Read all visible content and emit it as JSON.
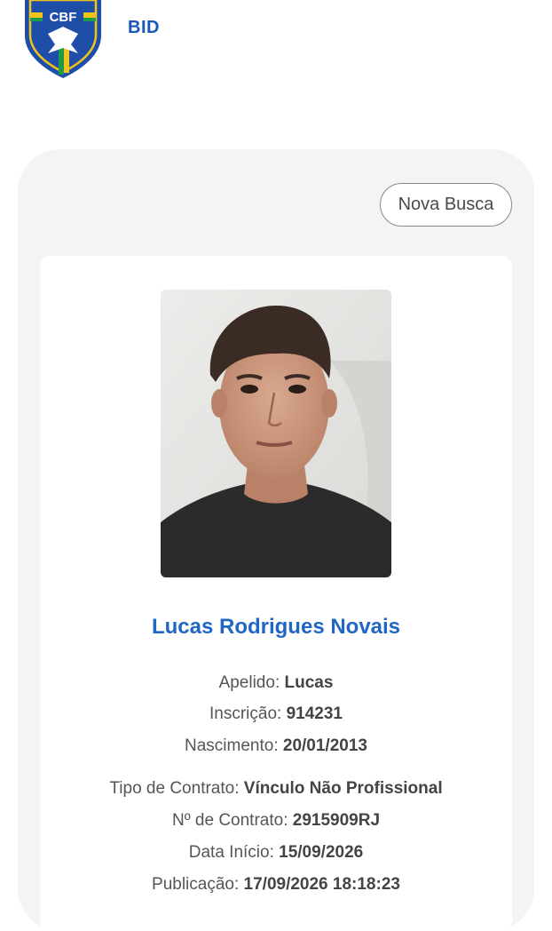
{
  "header": {
    "logo_text": "CBF",
    "app_name": "BID"
  },
  "actions": {
    "new_search_label": "Nova Busca"
  },
  "player": {
    "name": "Lucas Rodrigues Novais",
    "details": [
      {
        "label": "Apelido: ",
        "value": "Lucas"
      },
      {
        "label": "Inscrição: ",
        "value": "914231"
      },
      {
        "label": "Nascimento: ",
        "value": "20/01/2013"
      }
    ],
    "contract": [
      {
        "label": "Tipo de Contrato: ",
        "value": "Vínculo Não Profissional"
      },
      {
        "label": "Nº de Contrato: ",
        "value": "2915909RJ"
      },
      {
        "label": "Data Início: ",
        "value": "15/09/2026"
      },
      {
        "label": "Publicação: ",
        "value": "17/09/2026 18:18:23"
      }
    ]
  },
  "colors": {
    "accent": "#1f66c5",
    "logo_blue": "#1e4ea8",
    "logo_yellow": "#f2c31a",
    "logo_green": "#1d9a4a"
  }
}
